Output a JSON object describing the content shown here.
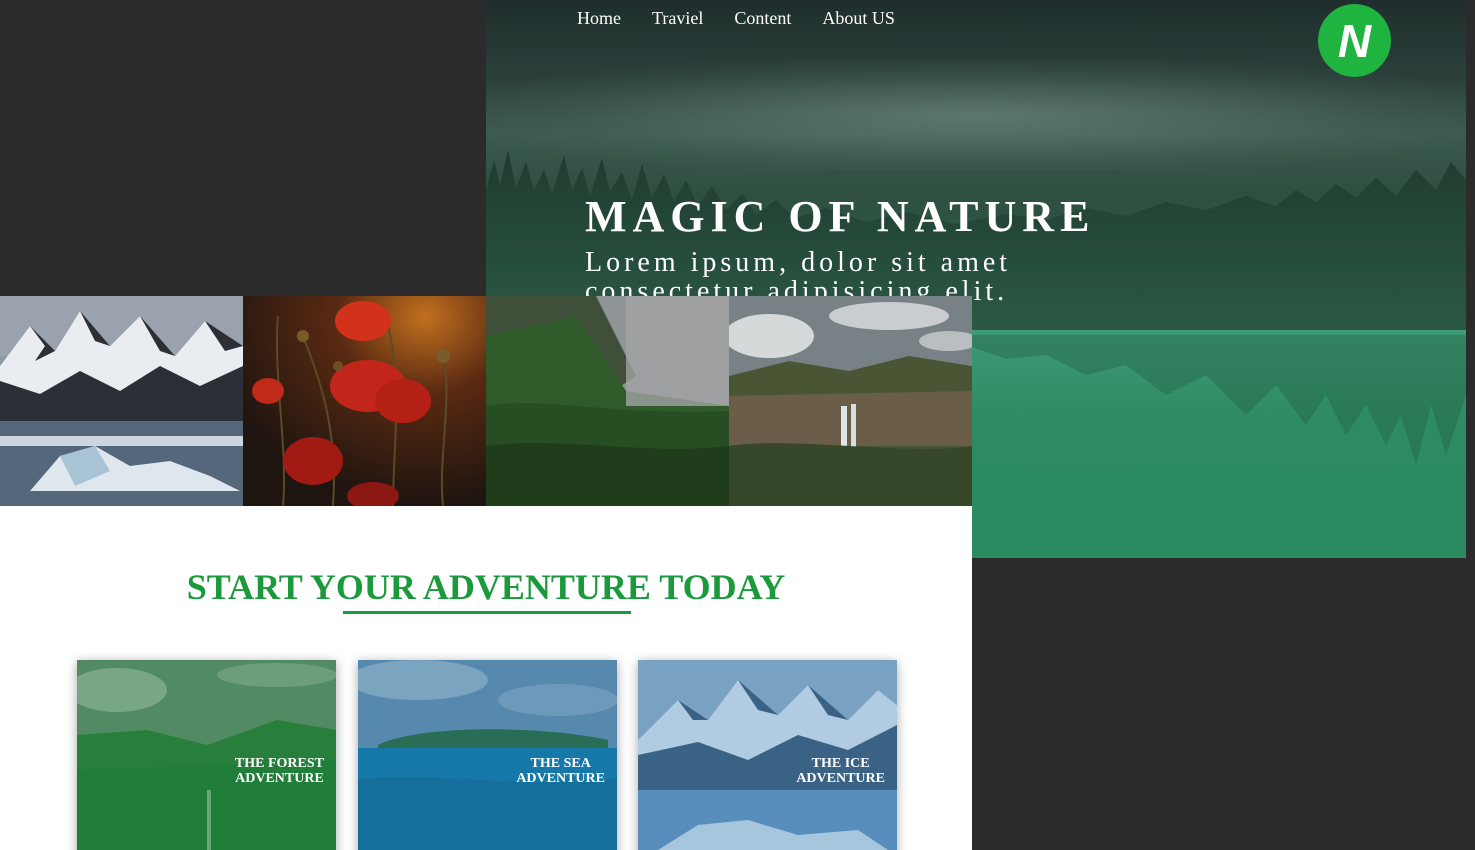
{
  "nav": {
    "items": [
      "Home",
      "Traviel",
      "Content",
      "About US"
    ]
  },
  "logo": {
    "letter": "N",
    "color": "#1fb33f"
  },
  "hero": {
    "title": "MAGIC OF NATURE",
    "subtitle": "Lorem ipsum, dolor sit amet consectetur adipisicing elit."
  },
  "gallery": [
    {
      "name": "snowy-mountains-icebergs"
    },
    {
      "name": "red-poppies"
    },
    {
      "name": "misty-green-valley"
    },
    {
      "name": "waterfall-canyon"
    }
  ],
  "section": {
    "title": "START YOUR ADVENTURE TODAY",
    "accent": "#1a9a3a"
  },
  "cards": [
    {
      "label_line1": "THE FOREST",
      "label_line2": "ADVENTURE",
      "tint": "#1c8a3c"
    },
    {
      "label_line1": "THE SEA",
      "label_line2": "ADVENTURE",
      "tint": "#1679a8"
    },
    {
      "label_line1": "THE ICE",
      "label_line2": "ADVENTURE",
      "tint": "#4a8fc4"
    }
  ]
}
